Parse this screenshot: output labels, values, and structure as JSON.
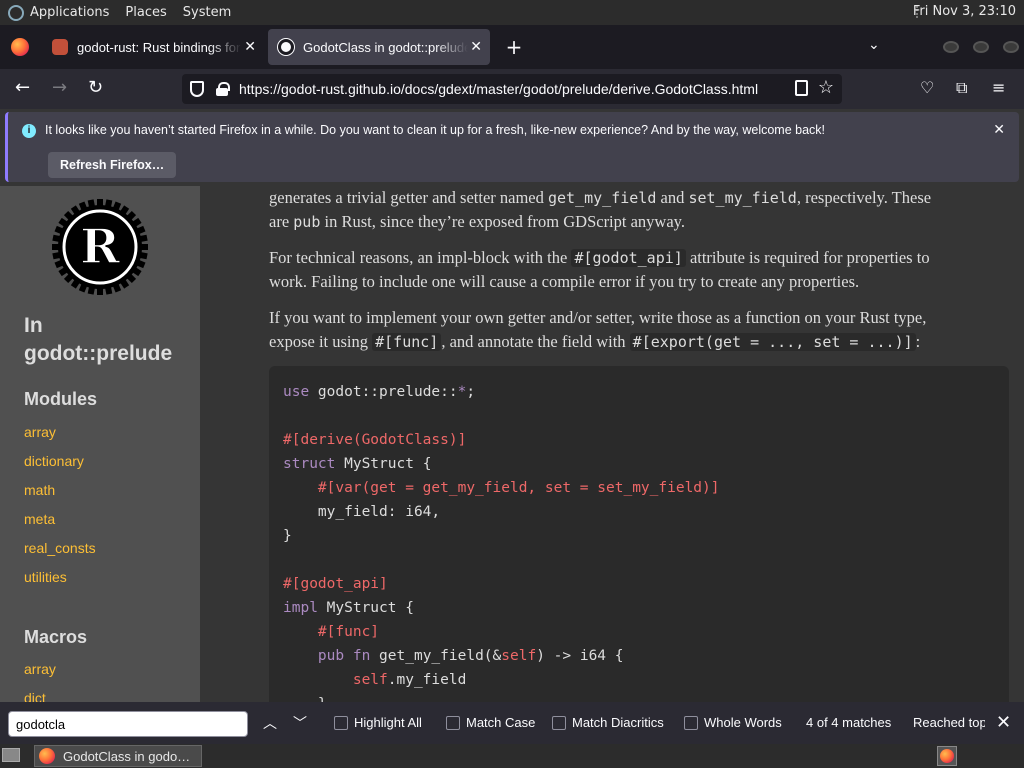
{
  "panel": {
    "applications": "Applications",
    "places": "Places",
    "system": "System",
    "clock": "Fri Nov  3, 23:10"
  },
  "tabs": [
    {
      "title": "godot-rust: Rust bindings for Godot",
      "icon": "godot-rust-favicon"
    },
    {
      "title": "GodotClass in godot::prelude - Rust",
      "icon": "rust-favicon"
    }
  ],
  "navbar": {
    "url": "https://godot-rust.github.io/docs/gdext/master/godot/prelude/derive.GodotClass.html"
  },
  "notification": {
    "message": "It looks like you haven’t started Firefox in a while. Do you want to clean it up for a fresh, like-new experience? And by the way, welcome back!",
    "button": "Refresh Firefox…"
  },
  "sidebar": {
    "location_prefix": "In",
    "location": "godot::prelude",
    "modules_heading": "Modules",
    "modules": [
      "array",
      "dictionary",
      "math",
      "meta",
      "real_consts",
      "utilities"
    ],
    "macros_heading": "Macros",
    "macros": [
      "array",
      "dict"
    ]
  },
  "content": {
    "p1_a": "generates a trivial getter and setter named ",
    "p1_code1": "get_my_field",
    "p1_b": " and ",
    "p1_code2": "set_my_field",
    "p1_c": ", respectively. These",
    "p1_line2_a": "are ",
    "p1_code3": "pub",
    "p1_line2_b": " in Rust, since they’re exposed from GDScript anyway.",
    "p2_a": "For technical reasons, an impl-block with the ",
    "p2_code": "#[godot_api]",
    "p2_b": " attribute is required for properties to",
    "p2_line2": "work. Failing to include one will cause a compile error if you try to create any properties.",
    "p3_line1": "If you want to implement your own getter and/or setter, write those as a function on your Rust type,",
    "p3_a": "expose it using ",
    "p3_code1": "#[func]",
    "p3_b": ", and annotate the field with ",
    "p3_code2": "#[export(get = ..., set = ...)]",
    "p3_c": ":"
  },
  "code": {
    "l1_kw": "use",
    "l1_rest": " godot::prelude::",
    "l1_star": "*",
    "l1_semi": ";",
    "l3": "#[derive(GodotClass)]",
    "l4_kw": "struct",
    "l4_rest": " MyStruct {",
    "l5": "    #[var(get = get_my_field, set = set_my_field)]",
    "l6": "    my_field: i64,",
    "l7": "}",
    "l9": "#[godot_api]",
    "l10_kw": "impl",
    "l10_rest": " MyStruct {",
    "l11": "    #[func]",
    "l12_kw1": "    pub",
    "l12_kw2": " fn",
    "l12_a": " get_my_field(&",
    "l12_self": "self",
    "l12_b": ") -> i64 {",
    "l13_self": "        self",
    "l13_rest": ".my_field",
    "l14": "    }"
  },
  "findbar": {
    "query": "godotcla",
    "highlight_all": "Highlight All",
    "match_case": "Match Case",
    "match_diacritics": "Match Diacritics",
    "whole_words": "Whole Words",
    "matches": "4 of 4 matches",
    "reached": "Reached top of page, continued from bottom"
  },
  "taskbar": {
    "task_title": "GodotClass in godo…"
  },
  "colors": {
    "link": "#fdbf35",
    "accent": "#8f7cff",
    "attribute": "#ee6868",
    "keyword": "#ab8ac1"
  }
}
